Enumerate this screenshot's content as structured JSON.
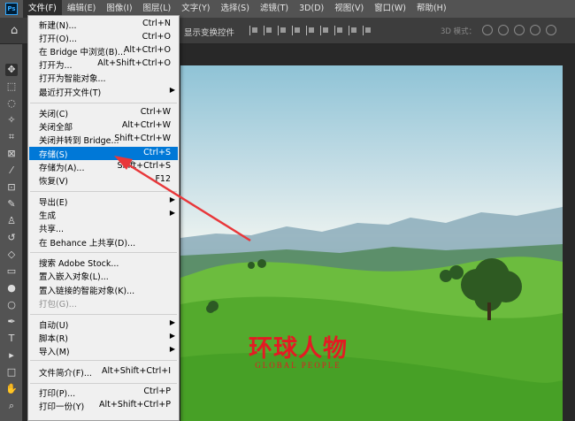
{
  "app": {
    "logo": "Ps"
  },
  "menubar": {
    "items": [
      {
        "label": "文件(F)"
      },
      {
        "label": "编辑(E)"
      },
      {
        "label": "图像(I)"
      },
      {
        "label": "图层(L)"
      },
      {
        "label": "文字(Y)"
      },
      {
        "label": "选择(S)"
      },
      {
        "label": "滤镜(T)"
      },
      {
        "label": "3D(D)"
      },
      {
        "label": "视图(V)"
      },
      {
        "label": "窗口(W)"
      },
      {
        "label": "帮助(H)"
      }
    ]
  },
  "options": {
    "transform_label": "显示变换控件",
    "mode3d_label": "3D 模式："
  },
  "file_menu": {
    "items": [
      {
        "label": "新建(N)...",
        "shortcut": "Ctrl+N"
      },
      {
        "label": "打开(O)...",
        "shortcut": "Ctrl+O"
      },
      {
        "label": "在 Bridge 中浏览(B)...",
        "shortcut": "Alt+Ctrl+O"
      },
      {
        "label": "打开为...",
        "shortcut": "Alt+Shift+Ctrl+O"
      },
      {
        "label": "打开为智能对象...",
        "shortcut": ""
      },
      {
        "label": "最近打开文件(T)",
        "shortcut": ""
      },
      {
        "label": "关闭(C)",
        "shortcut": "Ctrl+W"
      },
      {
        "label": "关闭全部",
        "shortcut": "Alt+Ctrl+W"
      },
      {
        "label": "关闭并转到 Bridge...",
        "shortcut": "Shift+Ctrl+W"
      },
      {
        "label": "存储(S)",
        "shortcut": "Ctrl+S"
      },
      {
        "label": "存储为(A)...",
        "shortcut": "Shift+Ctrl+S"
      },
      {
        "label": "恢复(V)",
        "shortcut": "F12"
      },
      {
        "label": "导出(E)",
        "shortcut": ""
      },
      {
        "label": "生成",
        "shortcut": ""
      },
      {
        "label": "共享...",
        "shortcut": ""
      },
      {
        "label": "在 Behance 上共享(D)...",
        "shortcut": ""
      },
      {
        "label": "搜索 Adobe Stock...",
        "shortcut": ""
      },
      {
        "label": "置入嵌入对象(L)...",
        "shortcut": ""
      },
      {
        "label": "置入链接的智能对象(K)...",
        "shortcut": ""
      },
      {
        "label": "打包(G)...",
        "shortcut": ""
      },
      {
        "label": "自动(U)",
        "shortcut": ""
      },
      {
        "label": "脚本(R)",
        "shortcut": ""
      },
      {
        "label": "导入(M)",
        "shortcut": ""
      },
      {
        "label": "文件简介(F)...",
        "shortcut": "Alt+Shift+Ctrl+I"
      },
      {
        "label": "打印(P)...",
        "shortcut": "Ctrl+P"
      },
      {
        "label": "打印一份(Y)",
        "shortcut": "Alt+Shift+Ctrl+P"
      }
    ]
  },
  "watermark": {
    "main": "环球人物",
    "sub": "GLOBAL PEOPLE"
  },
  "colors": {
    "highlight": "#0078d7",
    "arrow": "#e8373a",
    "brand": "#e31b23"
  }
}
